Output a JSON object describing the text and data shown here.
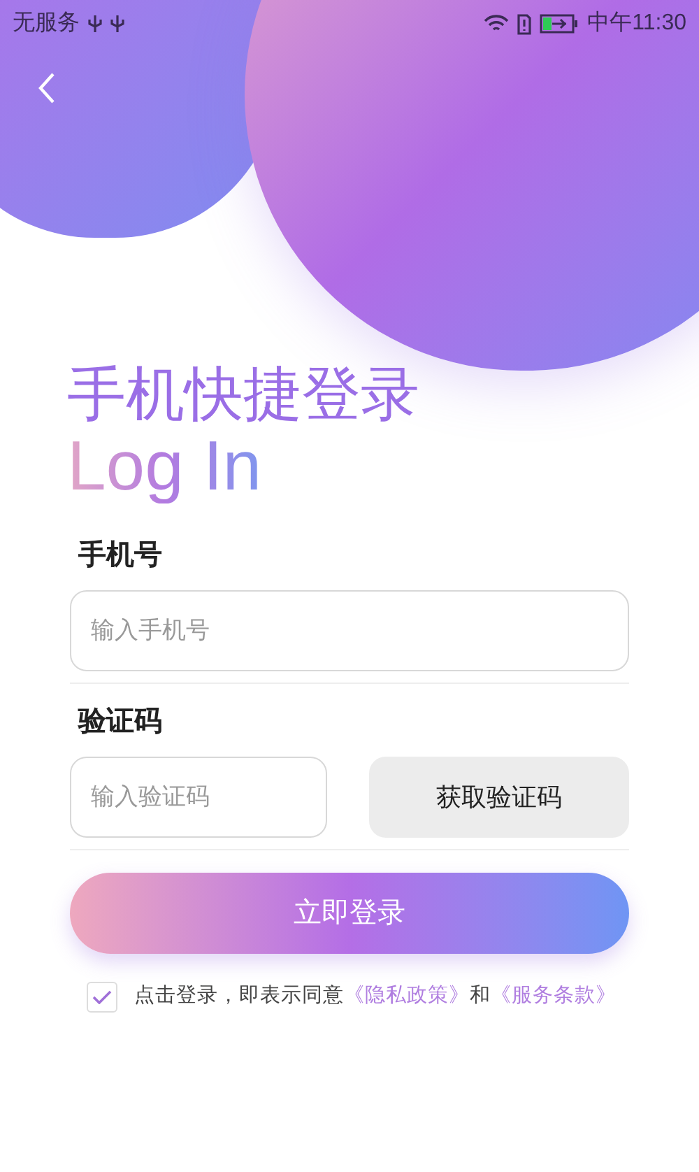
{
  "status_bar": {
    "carrier": "无服务",
    "time": "中午11:30"
  },
  "title": "手机快捷登录",
  "subtitle": "Log In",
  "phone": {
    "label": "手机号",
    "placeholder": "输入手机号"
  },
  "code": {
    "label": "验证码",
    "placeholder": "输入验证码",
    "button": "获取验证码"
  },
  "submit": "立即登录",
  "agreement": {
    "checked": true,
    "text": "点击登录，即表示同意",
    "privacy": "《隐私政策》",
    "and": "和",
    "terms": "《服务条款》"
  }
}
